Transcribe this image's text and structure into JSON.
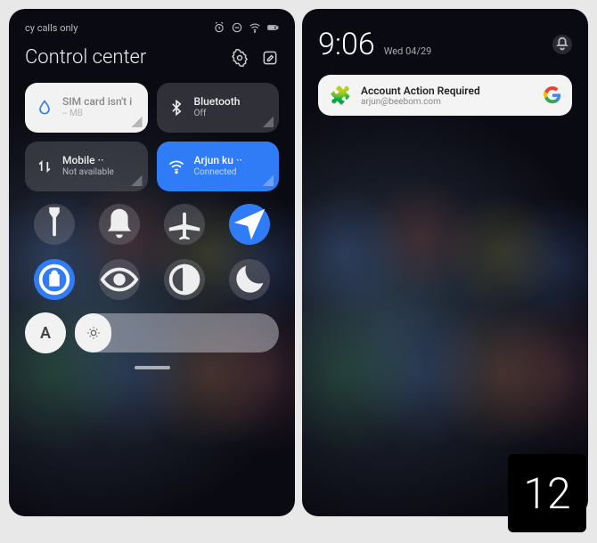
{
  "left": {
    "statusbar": {
      "carrier_text": "cy calls only"
    },
    "header": {
      "title": "Control center"
    },
    "tiles": {
      "sim": {
        "title": "SIM card isn't i",
        "sub": "-- MB"
      },
      "bt": {
        "title": "Bluetooth",
        "sub": "Off"
      },
      "data": {
        "title": "Mobile ··",
        "sub": "Not available"
      },
      "wifi": {
        "title": "Arjun ku ··",
        "sub": "Connected"
      }
    },
    "auto_label": "A"
  },
  "right": {
    "time": "9:06",
    "date": "Wed 04/29",
    "notification": {
      "title": "Account Action Required",
      "sub": "arjun@beebom.com"
    }
  },
  "version": "12"
}
